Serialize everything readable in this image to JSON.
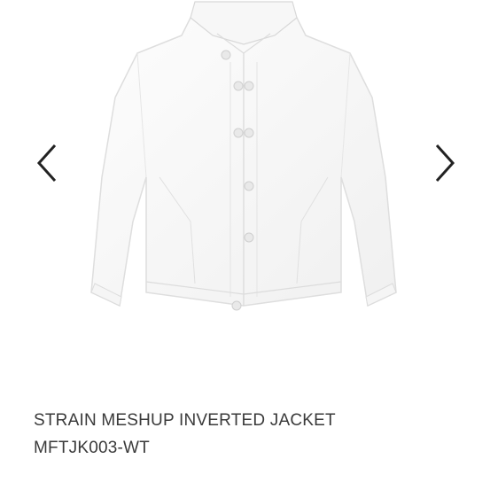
{
  "gallery": {
    "prev_icon": "chevron-left-icon",
    "next_icon": "chevron-right-icon",
    "arrow_color": "#222222"
  },
  "product": {
    "name": "STRAIN MESHUP INVERTED JACKET",
    "code": "MFTJK003-WT",
    "text_color": "#3a3a3a"
  }
}
